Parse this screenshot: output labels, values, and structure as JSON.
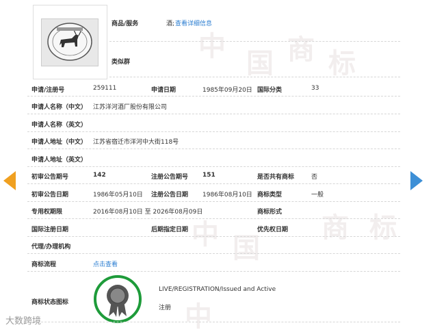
{
  "watermark": [
    "中",
    "国",
    "商",
    "标"
  ],
  "header": {
    "goods_label": "商品/服务",
    "goods_value": "酒;",
    "details_link": "查看详细信息",
    "similar_group_label": "类似群"
  },
  "logo_icon": "trademark-image-goat",
  "rows": {
    "reg_no_label": "申请/注册号",
    "reg_no_value": "259111",
    "apply_date_label": "申请日期",
    "apply_date_value": "1985年09月20日",
    "intl_class_label": "国际分类",
    "intl_class_value": "33",
    "applicant_cn_label": "申请人名称（中文）",
    "applicant_cn_value": "江苏洋河酒厂股份有限公司",
    "applicant_en_label": "申请人名称（英文）",
    "address_cn_label": "申请人地址（中文）",
    "address_cn_value": "江苏省宿迁市洋河中大街118号",
    "address_en_label": "申请人地址（英文）",
    "prelim_issue_label": "初审公告期号",
    "prelim_issue_value": "142",
    "reg_issue_label": "注册公告期号",
    "reg_issue_value": "151",
    "shared_label": "是否共有商标",
    "shared_value": "否",
    "prelim_date_label": "初审公告日期",
    "prelim_date_value": "1986年05月10日",
    "reg_date_label": "注册公告日期",
    "reg_date_value": "1986年08月10日",
    "mark_type_label": "商标类型",
    "mark_type_value": "一般",
    "exclusive_label": "专用权期限",
    "exclusive_value": "2016年08月10日 至 2026年08月09日",
    "mark_form_label": "商标形式",
    "intl_reg_date_label": "国际注册日期",
    "later_date_label": "后期指定日期",
    "priority_date_label": "优先权日期",
    "agent_label": "代理/办理机构",
    "process_label": "商标流程",
    "process_link": "点击查看",
    "status_icon_label": "商标状态图标",
    "status_en": "LIVE/REGISTRATION/Issued and Active",
    "status_cn": "注册"
  },
  "footer": {
    "brand": "大数跨境"
  },
  "colors": {
    "link": "#2b7ed1",
    "badge_ring": "#1e9b3a",
    "arrow_left": "#f0a020",
    "arrow_right": "#3d8fd6"
  }
}
